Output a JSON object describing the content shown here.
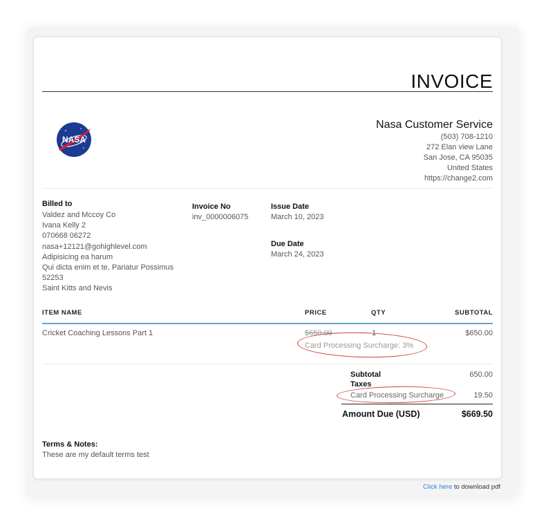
{
  "invoice": {
    "title": "INVOICE",
    "logo_text": "NASA",
    "company": {
      "name": "Nasa Customer Service",
      "phone": "(503) 708-1210",
      "address_line1": "272 Elan view Lane",
      "address_line2": "San Jose, CA 95035",
      "country": "United States",
      "website": "https://change2.com"
    },
    "billed_to": {
      "label": "Billed to",
      "lines": [
        "Valdez and Mccoy Co",
        "Ivana Kelly 2",
        "070668 06272",
        "nasa+12121@gohighlevel.com",
        "Adipisicing ea harum",
        "Qui dicta enim et te, Pariatur Possimus",
        "52253",
        "Saint Kitts and Nevis"
      ]
    },
    "invoice_no": {
      "label": "Invoice No",
      "value": "inv_0000006075"
    },
    "issue_date": {
      "label": "Issue Date",
      "value": "March 10, 2023"
    },
    "due_date": {
      "label": "Due Date",
      "value": "March 24, 2023"
    },
    "table": {
      "headers": {
        "item": "ITEM NAME",
        "price": "PRICE",
        "qty": "QTY",
        "subtotal": "SUBTOTAL"
      },
      "rows": [
        {
          "item": "Cricket Coaching Lessons Part 1",
          "price": "$650.00",
          "qty": "1",
          "subtotal": "$650.00",
          "note": "Card Processing Surcharge: 3%"
        }
      ]
    },
    "summary": {
      "subtotal_label": "Subtotal",
      "subtotal_value": "650.00",
      "taxes_label": "Taxes",
      "surcharge_label": "Card Processing Surcharge",
      "surcharge_value": "19.50",
      "amount_due_label": "Amount Due (USD)",
      "amount_due_value": "$669.50"
    },
    "terms": {
      "label": "Terms & Notes:",
      "text": "These are my default terms test"
    }
  },
  "footer": {
    "link_text": "Click here",
    "rest_text": "to download pdf"
  },
  "colors": {
    "accent_rule": "#6a9ed2",
    "annotation": "#d23a3a",
    "link": "#2f7fd0"
  }
}
